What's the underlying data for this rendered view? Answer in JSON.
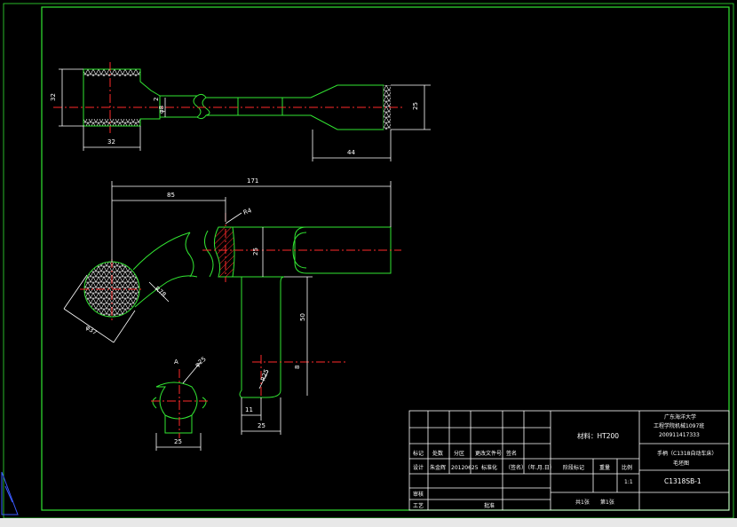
{
  "drawing": {
    "top_view_dims": {
      "d_left_height": "32",
      "d_left_length": "32",
      "d_shank": "φ8",
      "d_shank2": "2",
      "d_right_height": "25",
      "d_right_length": "44"
    },
    "front_view_dims": {
      "d_total_length": "171",
      "d_partial_length": "85",
      "d_r4": "R4",
      "d_25": "25",
      "d_r78": "R78",
      "d_phi37": "φ37",
      "d_50": "50",
      "d_8": "8",
      "d_r25": "R25",
      "d_11": "11",
      "d_25b": "25"
    },
    "section_view": {
      "label": "A",
      "d_phi25": "φ25",
      "d_width": "25"
    }
  },
  "title_block": {
    "material": "材料：HT200",
    "school": "广东海洋大学",
    "dept": "工程学院机械1097班",
    "student_no": "200911417333",
    "part_name": "手柄（C1318自动车床）",
    "drawing_type": "毛坯图",
    "drawing_no": "C1318SB-1",
    "labels": {
      "mark": "标记",
      "qty": "处数",
      "zone": "分区",
      "change_no": "更改文件号",
      "sign": "签名",
      "design": "设计",
      "designer": "朱金辉",
      "date": "20120625",
      "standardize": "标准化",
      "sign2": "（签名）",
      "ymd": "（年.月.日）",
      "stage_mark": "阶段标记",
      "weight": "重量",
      "scale": "比例",
      "scale_val": "1:1",
      "review": "审核",
      "process": "工艺",
      "approve": "批准",
      "sheets": "共1张",
      "sheet": "第1张"
    }
  }
}
